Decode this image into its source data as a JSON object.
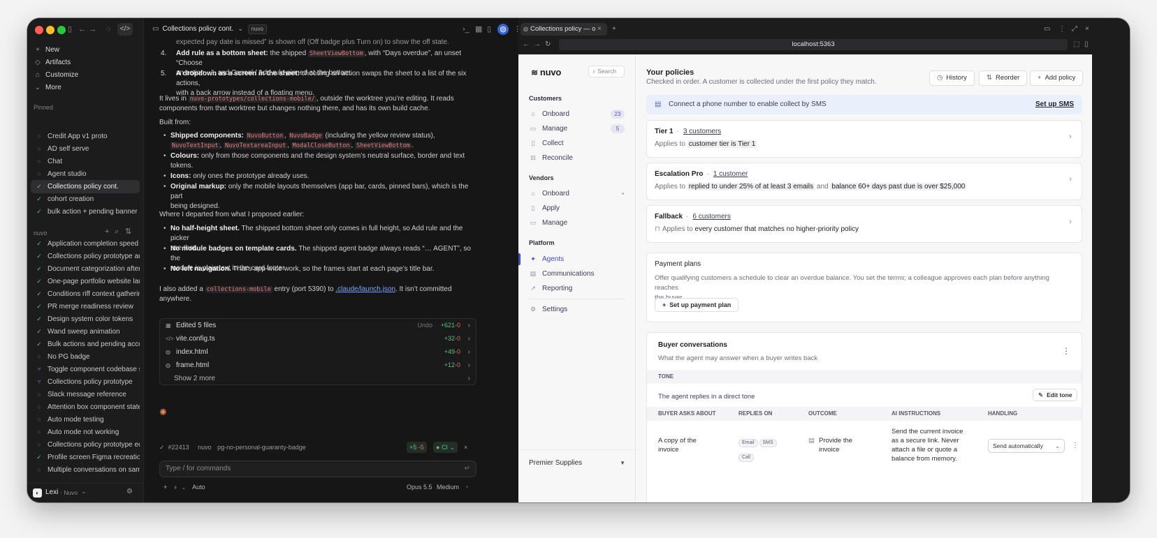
{
  "sidebar": {
    "nav": [
      {
        "icon": "plus-icon",
        "glyph": "+",
        "label": "New"
      },
      {
        "icon": "artifacts-icon",
        "glyph": "◇",
        "label": "Artifacts"
      },
      {
        "icon": "customize-icon",
        "glyph": "⌂",
        "label": "Customize"
      },
      {
        "icon": "chevron-down-icon",
        "glyph": "⌄",
        "label": "More"
      }
    ],
    "pinned_heading": "Pinned",
    "pinned": [
      {
        "label": "Credit App v1 proto",
        "status": "idle"
      },
      {
        "label": "AD self serve",
        "status": "idle"
      },
      {
        "label": "Chat",
        "status": "idle"
      },
      {
        "label": "Agent studio",
        "status": "idle"
      },
      {
        "label": "Collections policy cont.",
        "status": "ok",
        "active": true
      },
      {
        "label": "cohort creation",
        "status": "ok"
      },
      {
        "label": "bulk action + pending banner",
        "status": "ok"
      }
    ],
    "project_heading": "nuvo",
    "project_items": [
      {
        "label": "Application completion speed v",
        "status": "ok"
      },
      {
        "label": "Collections policy prototype au",
        "status": "ok"
      },
      {
        "label": "Document categorization after",
        "status": "ok"
      },
      {
        "label": "One-page portfolio website lau",
        "status": "ok"
      },
      {
        "label": "Conditions riff context gatherin",
        "status": "ok"
      },
      {
        "label": "PR merge readiness review",
        "status": "ok"
      },
      {
        "label": "Design system color tokens",
        "status": "ok"
      },
      {
        "label": "Wand sweep animation",
        "status": "ok"
      },
      {
        "label": "Bulk actions and pending accou",
        "status": "ok"
      },
      {
        "label": "No PG badge",
        "status": "idle"
      },
      {
        "label": "Toggle component codebase sta",
        "status": "br"
      },
      {
        "label": "Collections policy prototype",
        "status": "br"
      },
      {
        "label": "Slack message reference",
        "status": "idle"
      },
      {
        "label": "Attention box component state",
        "status": "idle"
      },
      {
        "label": "Auto mode testing",
        "status": "idle"
      },
      {
        "label": "Auto mode not working",
        "status": "idle"
      },
      {
        "label": "Collections policy prototype ed",
        "status": "idle"
      },
      {
        "label": "Profile screen Figma recreation",
        "status": "ok"
      },
      {
        "label": "Multiple conversations on same",
        "status": "idle"
      }
    ],
    "user_name": "Lexi",
    "user_org": "· Nuvo"
  },
  "chat": {
    "title": "Collections policy cont.",
    "tag": "nuvo",
    "top_fragment": "expected pay date is missed” is shown off (Off badge plus Turn on) to show the off state.",
    "ol4_bold": "Add rule as a bottom sheet:",
    "ol4_a": " the shipped ",
    "ol4_code": "SheetViewBottom",
    "ol4_b": ", with “Days overdue”, an unset “Choose",
    "ol4_c": "an action…”, and Cancel / Add rule pinned at the bottom.",
    "ol5_bold": "A dropdown as a screen in the sheet:",
    "ol5_a": " choosing an action swaps the sheet to a list of the six actions,",
    "ol5_b": "with a back arrow instead of a floating menu.",
    "p1_a": "It lives in ",
    "p1_code": "nuvo-prototypes/collections-mobile/",
    "p1_b": ", outside the worktree you’re editing. It reads",
    "p1_c": "components from that worktree but changes nothing there, and has its own build cache.",
    "built_from": "Built from:",
    "b1_bold": "Shipped components:",
    "b1_code1": "NuvoButton",
    "b1_code2": "NuvoBadge",
    "b1_a": " (including the yellow review status),",
    "b1_code3": "NuvoTextInput",
    "b1_code4": "NuvoTextareaInput",
    "b1_code5": "ModalCloseButton",
    "b1_code6": "SheetViewBottom",
    "b2_bold": "Colours:",
    "b2_a": " only from those components and the design system’s neutral surface, border and text",
    "b2_b": "tokens.",
    "b3_bold": "Icons:",
    "b3_a": " only ones the prototype already uses.",
    "b4_bold": "Original markup:",
    "b4_a": " only the mobile layouts themselves (app bar, cards, pinned bars), which is the part",
    "b4_b": "being designed.",
    "departed": "Where I departed from what I proposed earlier:",
    "d1_bold": "No half-height sheet.",
    "d1_a": " The shipped bottom sheet only comes in full height, so Add rule and the picker",
    "d1_b": "use that.",
    "d2_bold": "No module badges on template cards.",
    "d2_a": " The shipped agent badge always reads “… AGENT”, so the",
    "d2_b": "module is plain text in the card footer.",
    "d3_bold": "No left navigation.",
    "d3_a": " That’s app-wide work, so the frames start at each page’s title bar.",
    "p2_a": "I also added a ",
    "p2_code": "collections-mobile",
    "p2_b": " entry (port 5390) to ",
    "p2_link": ".claude/launch.json",
    "p2_c": ". It isn’t committed anywhere.",
    "files_header": "Edited 5 files",
    "undo": "Undo",
    "total_add": "+621",
    "total_del": "-0",
    "files": [
      {
        "icon": "code-icon",
        "glyph": "</>",
        "name": "vite.config.ts",
        "add": "+32",
        "del": "-0"
      },
      {
        "icon": "globe-icon",
        "glyph": "◍",
        "name": "index.html",
        "add": "+49",
        "del": "-0"
      },
      {
        "icon": "globe-icon",
        "glyph": "◍",
        "name": "frame.html",
        "add": "+12",
        "del": "-0"
      }
    ],
    "show_more": "Show 2 more",
    "pr_number": "#22413",
    "pr_repo": "nuvo",
    "pr_branch": "pg-no-personal-guaranty-badge",
    "pr_add": "+5",
    "pr_del": "-5",
    "pr_ci": "CI",
    "composer_placeholder": "Type / for commands",
    "mode": "Auto",
    "model": "Opus 5.5",
    "effort": "Medium"
  },
  "browser": {
    "tab_title": "Collections policy — o",
    "url": "localhost:5363"
  },
  "app": {
    "brand": "nuvo",
    "search": "Search",
    "customers_heading": "Customers",
    "customers": [
      {
        "icon": "inbox-icon",
        "glyph": "⌂",
        "label": "Onboard",
        "count": "23"
      },
      {
        "icon": "folder-icon",
        "glyph": "▭",
        "label": "Manage",
        "count": "5"
      },
      {
        "icon": "collect-icon",
        "glyph": "▯",
        "label": "Collect"
      },
      {
        "icon": "reconcile-icon",
        "glyph": "⊟",
        "label": "Reconcile"
      }
    ],
    "vendors_heading": "Vendors",
    "vendors": [
      {
        "icon": "inbox-icon",
        "glyph": "⌂",
        "label": "Onboard"
      },
      {
        "icon": "document-icon",
        "glyph": "▯",
        "label": "Apply"
      },
      {
        "icon": "folder-icon",
        "glyph": "▭",
        "label": "Manage"
      }
    ],
    "platform_heading": "Platform",
    "platform": [
      {
        "icon": "sparkle-icon",
        "glyph": "✦",
        "label": "Agents",
        "active": true
      },
      {
        "icon": "message-icon",
        "glyph": "▤",
        "label": "Communications"
      },
      {
        "icon": "chart-icon",
        "glyph": "↗",
        "label": "Reporting"
      }
    ],
    "settings": "Settings",
    "org": "Premier Supplies",
    "header_title": "Your policies",
    "header_sub": "Checked in order. A customer is collected under the first policy they match.",
    "btn_history": "History",
    "btn_reorder": "Reorder",
    "btn_add": "Add policy",
    "banner_text": "Connect a phone number to enable collect by SMS",
    "banner_link": "Set up SMS",
    "policies": [
      {
        "name": "Tier 1",
        "customers": "3 customers",
        "applies": "Applies to",
        "rule": "customer tier is Tier 1"
      },
      {
        "name": "Escalation Pro",
        "customers": "1 customer",
        "applies": "Applies to",
        "rule": "replied to under 25% of at least 3 emails",
        "and": "and",
        "rule2": "balance 60+ days past due is over $25,000"
      },
      {
        "name": "Fallback",
        "customers": "6 customers",
        "applies": "Applies to",
        "rule": "every customer that matches no higher-priority policy"
      }
    ],
    "plans_title": "Payment plans",
    "plans_desc1": "Offer qualifying customers a schedule to clear an overdue balance. You set the terms; a colleague approves each plan before anything reaches",
    "plans_desc2": "the buyer.",
    "plans_btn": "Set up payment plan",
    "conv_title": "Buyer conversations",
    "conv_sub": "What the agent may answer when a buyer writes back",
    "tone_heading": "TONE",
    "tone_text": "The agent replies in a direct tone",
    "tone_btn": "Edit tone",
    "cols": [
      "BUYER ASKS ABOUT",
      "REPLIES ON",
      "OUTCOME",
      "AI INSTRUCTIONS",
      "HANDLING"
    ],
    "row": {
      "asks1": "A copy of the",
      "asks2": "invoice",
      "chips": [
        "Email",
        "SMS",
        "Call"
      ],
      "outcome1": "Provide the",
      "outcome2": "invoice",
      "instr": [
        "Send the current invoice",
        "as a secure link. Never",
        "attach a file or quote a",
        "balance from memory."
      ],
      "handling": "Send automatically"
    }
  }
}
